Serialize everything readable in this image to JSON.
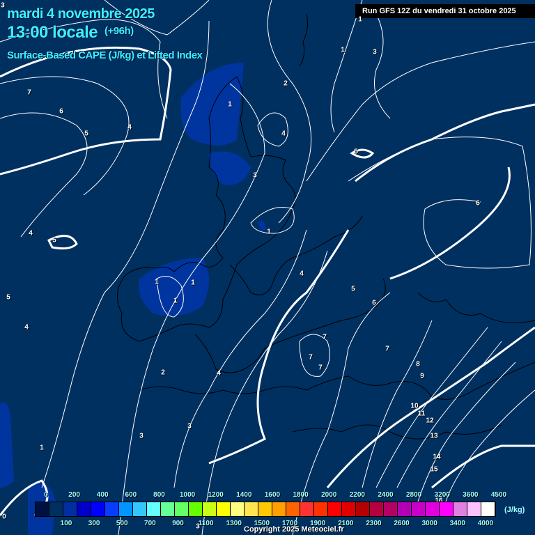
{
  "header": {
    "date": "mardi 4 novembre 2025",
    "time": "13:00 locale",
    "lead": "(+96h)",
    "parameter": "Surface-Based CAPE (J/kg) et Lifted Index",
    "run": "Run GFS 12Z du vendredi 31 octobre 2025"
  },
  "contour_labels": [
    "3",
    "7",
    "6",
    "5",
    "4",
    "1",
    "2",
    "1",
    "3",
    "4",
    "5",
    "3",
    "1",
    "6",
    "4",
    "5",
    "1",
    "1",
    "1",
    "1",
    "5",
    "4",
    "4",
    "5",
    "6",
    "7",
    "7",
    "7",
    "7",
    "8",
    "9",
    "10",
    "11",
    "12",
    "13",
    "14",
    "15",
    "2",
    "4",
    "3",
    "3",
    "1",
    "0",
    "16",
    "3"
  ],
  "legend": {
    "unit": "(J/kg)",
    "top_labels": [
      "0",
      "200",
      "400",
      "600",
      "800",
      "1000",
      "1200",
      "1400",
      "1600",
      "1800",
      "2000",
      "2200",
      "2400",
      "2800",
      "3200",
      "3600",
      "4500"
    ],
    "bottom_labels": [
      "100",
      "300",
      "500",
      "700",
      "900",
      "1100",
      "1300",
      "1500",
      "1700",
      "1900",
      "2100",
      "2300",
      "2600",
      "3000",
      "3400",
      "4000"
    ],
    "colors": [
      "#001040",
      "#003060",
      "#0030a0",
      "#0000c8",
      "#0000ff",
      "#0a3cff",
      "#0096ff",
      "#32c8ff",
      "#64ffff",
      "#64ff96",
      "#64ff64",
      "#64ff00",
      "#c8ff14",
      "#ffff00",
      "#ffff80",
      "#ffe650",
      "#ffc800",
      "#ffa000",
      "#ff6400",
      "#ff3232",
      "#ff3200",
      "#ff0000",
      "#e00000",
      "#b40000",
      "#b40040",
      "#b40064",
      "#b400b4",
      "#c800c8",
      "#e000e0",
      "#ff00ff",
      "#e080e0",
      "#ffc0ff",
      "#ffffff"
    ]
  },
  "copyright": "Copyright 2025 Meteociel.fr"
}
